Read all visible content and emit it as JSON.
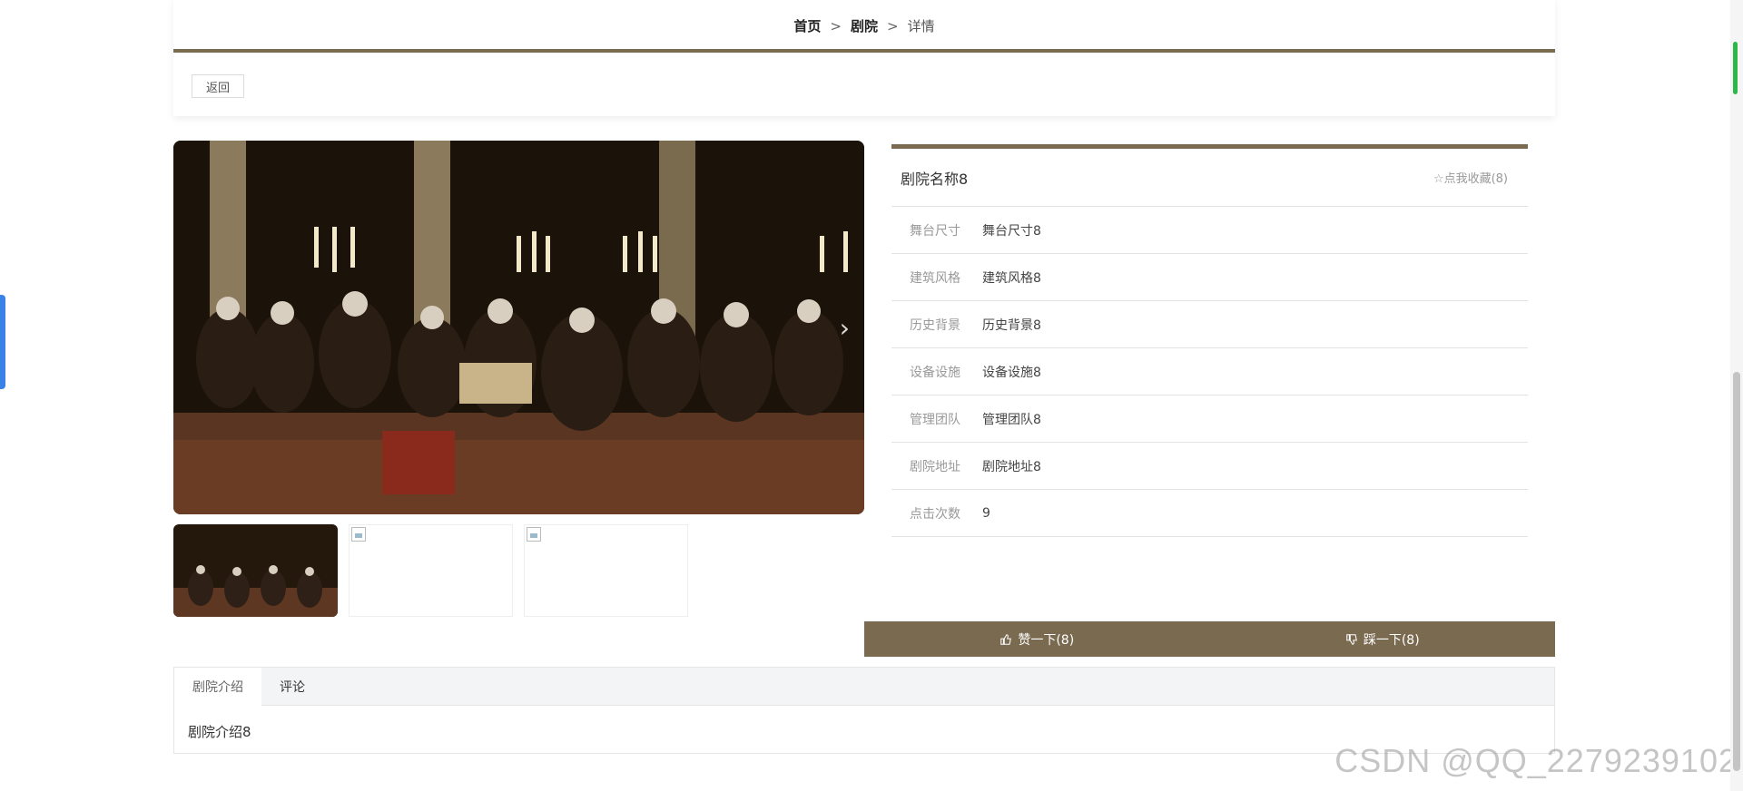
{
  "breadcrumb": {
    "home": "首页",
    "section": "剧院",
    "current": "详情",
    "separator": ">"
  },
  "back_label": "返回",
  "theater": {
    "name": "剧院名称8",
    "favorite_label": "☆点我收藏(8)",
    "fields": [
      {
        "label": "舞台尺寸",
        "value": "舞台尺寸8"
      },
      {
        "label": "建筑风格",
        "value": "建筑风格8"
      },
      {
        "label": "历史背景",
        "value": "历史背景8"
      },
      {
        "label": "设备设施",
        "value": "设备设施8"
      },
      {
        "label": "管理团队",
        "value": "管理团队8"
      },
      {
        "label": "剧院地址",
        "value": "剧院地址8"
      },
      {
        "label": "点击次数",
        "value": "9"
      }
    ]
  },
  "actions": {
    "like_label": "赞一下(8)",
    "dislike_label": "踩一下(8)"
  },
  "tabs": [
    {
      "label": "剧院介绍"
    },
    {
      "label": "评论"
    }
  ],
  "tab_content": "剧院介绍8",
  "watermark": "CSDN @QQ_2279239102",
  "colors": {
    "accent": "#7a6a50",
    "left_tab": "#3a82e8"
  }
}
